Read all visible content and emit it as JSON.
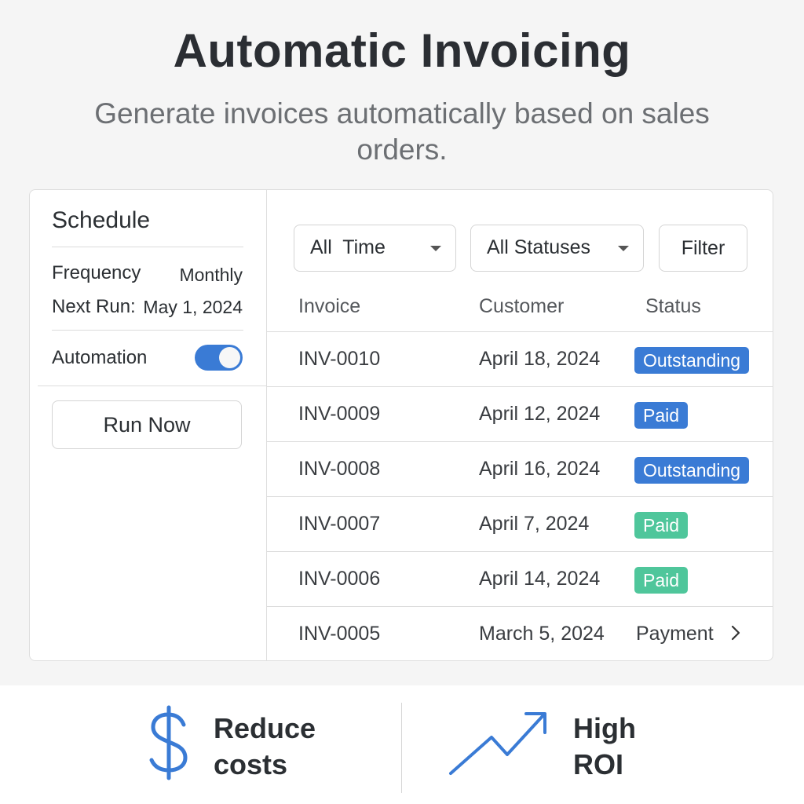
{
  "header": {
    "title": "Automatic Invoicing",
    "subtitle": "Generate invoices automatically based on sales orders."
  },
  "schedule": {
    "title": "Schedule",
    "frequency_label": "Frequency",
    "frequency_value": "Monthly",
    "next_run_label": "Next Run:",
    "next_run_value": "May 1, 2024",
    "automation_label": "Automation",
    "automation_enabled": true,
    "run_now_label": "Run Now"
  },
  "filters": {
    "time": "All  Time",
    "status": "All Statuses",
    "filter_label": "Filter"
  },
  "table": {
    "columns": [
      "Invoice",
      "Customer",
      "Status"
    ],
    "rows": [
      {
        "invoice": "INV-0010",
        "customer": "April 18, 2024",
        "status": "Outstanding"
      },
      {
        "invoice": "INV-0009",
        "customer": "April 12, 2024",
        "status": "Paid"
      },
      {
        "invoice": "INV-0008",
        "customer": "April 16, 2024",
        "status": "Outstanding"
      },
      {
        "invoice": "INV-0007",
        "customer": "April 7, 2024",
        "status": "Paid"
      },
      {
        "invoice": "INV-0006",
        "customer": "April 14, 2024",
        "status": "Paid"
      },
      {
        "invoice": "INV-0005",
        "customer": "March 5, 2024",
        "status": "Payment"
      }
    ]
  },
  "benefits": {
    "left": {
      "line1": "Reduce",
      "line2": "costs",
      "icon": "dollar-icon"
    },
    "right": {
      "line1": "High",
      "line2": "ROI",
      "icon": "trend-up-icon"
    }
  },
  "colors": {
    "accent": "#3a7bd5",
    "badge_outstanding": "#3a7bd5",
    "badge_paid_blue": "#3a7bd5",
    "badge_paid_green": "#4fc69b"
  }
}
